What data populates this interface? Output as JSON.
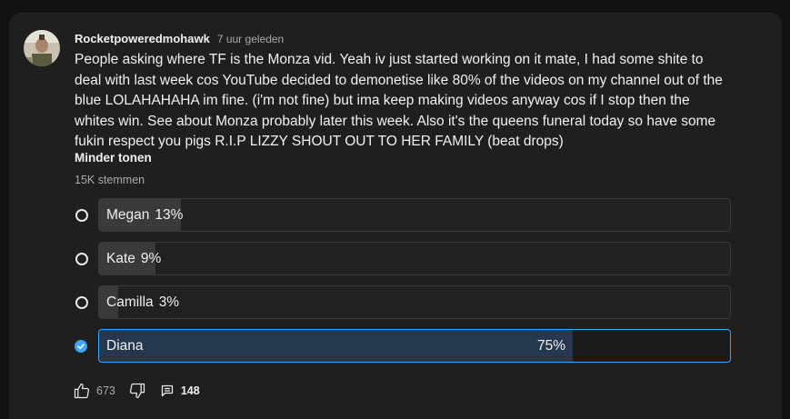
{
  "comment": {
    "author": "Rocketpoweredmohawk",
    "time": "7 uur geleden",
    "text": "People asking where TF is the Monza vid. Yeah iv just started working on it mate, I had some shite to deal with last week cos YouTube decided to demonetise like 80% of the videos on my channel out of the blue LOLAHAHAHA im fine. (i'm not fine) but ima keep making videos anyway cos if I stop then the whites win. See about Monza probably later this week. Also it's the queens funeral today so have some fukin respect you pigs R.I.P LIZZY SHOUT OUT TO HER FAMILY (beat drops)",
    "show_less": "Minder tonen"
  },
  "poll": {
    "votes_label": "15K stemmen",
    "options": [
      {
        "label": "Megan",
        "percent_text": "13%",
        "percent": 13,
        "selected": false
      },
      {
        "label": "Kate",
        "percent_text": "9%",
        "percent": 9,
        "selected": false
      },
      {
        "label": "Camilla",
        "percent_text": "3%",
        "percent": 3,
        "selected": false
      },
      {
        "label": "Diana",
        "percent_text": "75%",
        "percent": 75,
        "selected": true
      }
    ]
  },
  "actions": {
    "like_count": "673",
    "reply_count": "148"
  },
  "colors": {
    "accent": "#3ea6ff",
    "background": "#121212",
    "card": "#1f1f1f"
  }
}
